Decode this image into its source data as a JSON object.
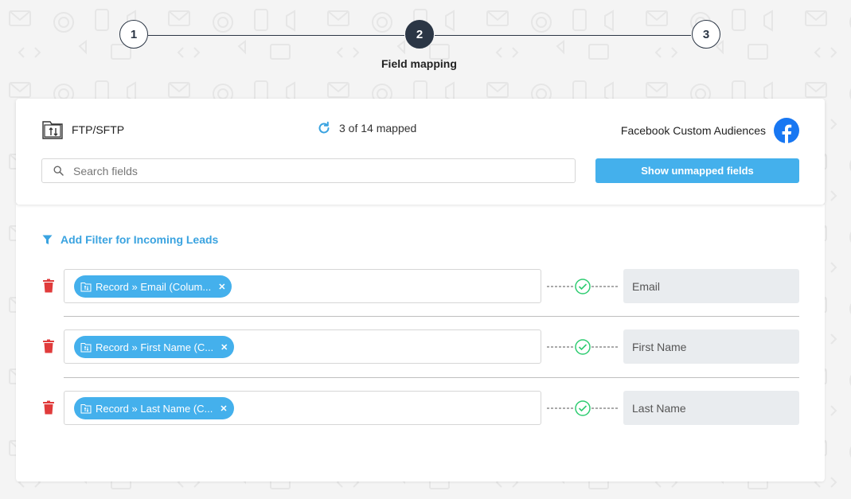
{
  "stepper": {
    "steps": [
      {
        "number": "1",
        "state": "inactive"
      },
      {
        "number": "2",
        "state": "active",
        "label": "Field mapping"
      },
      {
        "number": "3",
        "state": "inactive"
      }
    ]
  },
  "header": {
    "source_label": "FTP/SFTP",
    "source_icon": "ftp-folder-icon",
    "mapped_status": "3 of 14 mapped",
    "refresh_icon": "refresh-icon",
    "destination_label": "Facebook Custom Audiences",
    "destination_icon": "facebook-icon",
    "search_placeholder": "Search fields",
    "show_unmapped_label": "Show unmapped fields"
  },
  "filter": {
    "label": "Add Filter for Incoming Leads",
    "icon": "filter-icon"
  },
  "mappings": [
    {
      "source_chip": "Record » Email (Colum...",
      "destination": "Email",
      "status": "mapped"
    },
    {
      "source_chip": "Record » First Name (C...",
      "destination": "First Name",
      "status": "mapped"
    },
    {
      "source_chip": "Record » Last Name (C...",
      "destination": "Last Name",
      "status": "mapped"
    }
  ],
  "colors": {
    "accent": "#44b0ec",
    "link": "#3aa3e0",
    "dark": "#2b3645",
    "success": "#2ecc71",
    "danger": "#e03b3b",
    "facebook": "#1877f2"
  }
}
